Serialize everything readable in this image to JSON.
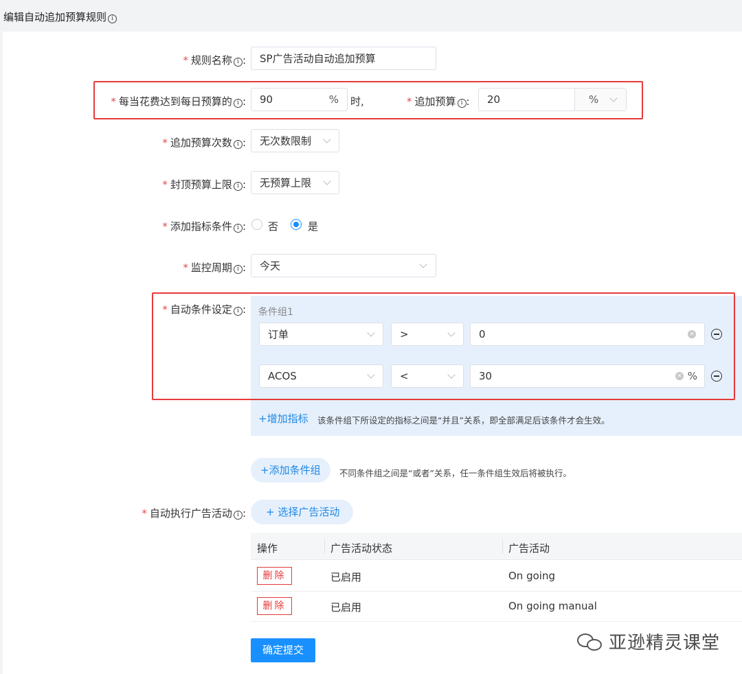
{
  "page": {
    "title": "编辑自动追加预算规则"
  },
  "form": {
    "rule_name": {
      "label": "规则名称",
      "value": "SP广告活动自动追加预算"
    },
    "spend_threshold": {
      "label": "每当花费达到每日预算的",
      "value": "90",
      "suffix": "%",
      "after": "时,"
    },
    "add_budget": {
      "label": "追加预算",
      "value": "20",
      "unit": "%"
    },
    "add_count": {
      "label": "追加预算次数",
      "value": "无次数限制"
    },
    "budget_cap": {
      "label": "封顶预算上限",
      "value": "无预算上限"
    },
    "add_metric_condition": {
      "label": "添加指标条件",
      "options": [
        "否",
        "是"
      ],
      "selected": "是"
    },
    "monitor_period": {
      "label": "监控周期",
      "value": "今天"
    },
    "auto_conditions": {
      "label": "自动条件设定",
      "group_title": "条件组1",
      "rows": [
        {
          "metric": "订单",
          "operator": ">",
          "value": "0",
          "suffix": ""
        },
        {
          "metric": "ACOS",
          "operator": "<",
          "value": "30",
          "suffix": "%"
        }
      ],
      "add_metric_label": "+增加指标",
      "add_metric_hint": "该条件组下所设定的指标之间是“并且”关系，即全部满足后该条件才会生效。",
      "add_group_label": "+添加条件组",
      "add_group_hint": "不同条件组之间是“或者”关系，任一条件组生效后将被执行。"
    },
    "auto_campaigns": {
      "label": "自动执行广告活动",
      "select_label": "+ 选择广告活动",
      "columns": [
        "操作",
        "广告活动状态",
        "广告活动"
      ],
      "rows": [
        {
          "action": "删除",
          "status": "已启用",
          "campaign": "On going"
        },
        {
          "action": "删除",
          "status": "已启用",
          "campaign": "On going manual"
        }
      ]
    },
    "submit_label": "确定提交"
  },
  "watermark": "亚逊精灵课堂",
  "colors": {
    "accent": "#1890ff",
    "highlight": "#e5393a",
    "panel": "#e6f0fc"
  }
}
